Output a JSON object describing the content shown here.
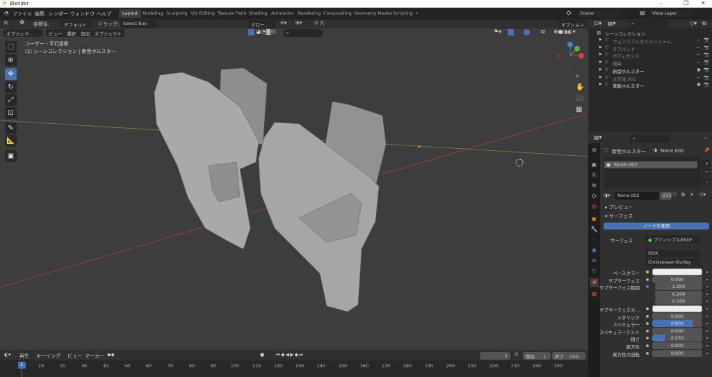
{
  "window": {
    "title": "Blender"
  },
  "menu": [
    "ファイル",
    "編集",
    "レンダー",
    "ウィンドウ",
    "ヘルプ"
  ],
  "workspaces": [
    "Layout",
    "Modeling",
    "Sculpting",
    "UV Editing",
    "Texture Paint",
    "Shading",
    "Animation",
    "Rendering",
    "Compositing",
    "Geometry Nodes",
    "Scripting",
    "+"
  ],
  "scene": {
    "scene_name": "Scene",
    "view_layer": "View Layer"
  },
  "tool_header": {
    "coord_label": "座標系:",
    "orientation": "デフォルト",
    "drag_label": "ドラッグ:",
    "drag_value": "Select Box",
    "transform": "グロー…",
    "options": "オプション"
  },
  "viewport_header": {
    "mode": "オブジェク…",
    "menus": [
      "ビュー",
      "選択",
      "追加",
      "オブジェクト"
    ]
  },
  "viewport": {
    "view_name": "ユーザー・平行投影",
    "collection_info": "(1) シーンコレクション | 新型ホルスター"
  },
  "outliner": {
    "root": "シーンコレクション",
    "items": [
      {
        "name": "ウェアラブルカメラシステム",
        "visible": false
      },
      {
        "name": "タフパッド",
        "visible": false
      },
      {
        "name": "ボディカメラ",
        "visible": false
      },
      {
        "name": "帽章",
        "visible": false
      },
      {
        "name": "新型ホルスター",
        "visible": true
      },
      {
        "name": "立方体.001",
        "visible": false
      },
      {
        "name": "革製ホルスター",
        "visible": true
      }
    ]
  },
  "properties": {
    "object": "新型ホルスター",
    "material": "None.002",
    "slot": "None.002",
    "users": "213",
    "preview": "プレビュー",
    "surface_panel": "サーフェス",
    "use_nodes": "ノードを使用",
    "surface_label": "サーフェス",
    "shader": "プリンシプルBSDF",
    "distribution": "GGX",
    "subsurface_method": "Christensen-Burley",
    "rows": [
      {
        "label": "ベースカラー",
        "type": "color",
        "dot": "#c8c84a"
      },
      {
        "label": "サブサーフェス",
        "value": "0.000"
      },
      {
        "label": "サブサーフェス範囲",
        "value": "1.000",
        "dot": "#7070c8"
      },
      {
        "label": "",
        "value": "0.200",
        "nodot": true
      },
      {
        "label": "",
        "value": "0.100",
        "nodot": true
      },
      {
        "label": "サブサーフェスカ…",
        "type": "color",
        "dot": "#c8c84a"
      },
      {
        "label": "メタリック",
        "value": "0.000"
      },
      {
        "label": "スペキュラー",
        "value": "0.800",
        "fill": 0.8
      },
      {
        "label": "スペキュラーチント",
        "value": "0.000"
      },
      {
        "label": "粗さ",
        "value": "0.255",
        "fill": 0.255
      },
      {
        "label": "異方性",
        "value": "0.000"
      },
      {
        "label": "異方性の回転",
        "value": "0.000"
      }
    ]
  },
  "timeline": {
    "menus": [
      "再生",
      "キーイング",
      "ビュー",
      "マーカー"
    ],
    "current_frame": "1",
    "start_label": "開始",
    "start": "1",
    "end_label": "終了",
    "end": "250",
    "ticks": [
      "10",
      "20",
      "30",
      "40",
      "50",
      "60",
      "70",
      "80",
      "90",
      "100",
      "110",
      "120",
      "130",
      "140",
      "150",
      "160",
      "170",
      "180",
      "190",
      "200",
      "210",
      "220",
      "230",
      "240",
      "250"
    ]
  },
  "colors": {
    "accent": "#4772b3",
    "viewport_bg": "#3d3d3d",
    "header": "#303030"
  }
}
